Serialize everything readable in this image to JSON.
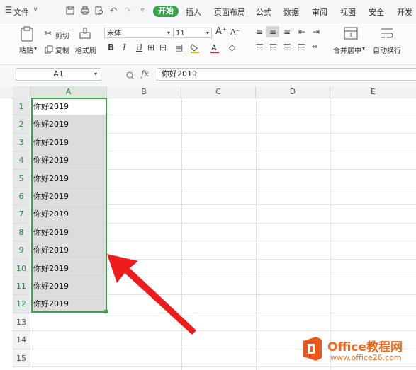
{
  "menubar": {
    "file": "文件",
    "tabs": [
      "开始",
      "插入",
      "页面布局",
      "公式",
      "数据",
      "审阅",
      "视图",
      "安全",
      "开发"
    ],
    "accent": "#3aa34c"
  },
  "ribbon": {
    "paste": "粘贴",
    "cut": "剪切",
    "copy": "复制",
    "format_painter": "格式刷",
    "font_name": "宋体",
    "font_size": "11",
    "bold": "B",
    "italic": "I",
    "underline": "U",
    "merge_center": "合并居中",
    "wrap_text": "自动换行"
  },
  "formula_bar": {
    "name_box": "A1",
    "fx_label": "fx",
    "value": "你好2019"
  },
  "sheet": {
    "columns": [
      "A",
      "B",
      "C",
      "D",
      "E"
    ],
    "rows": [
      "1",
      "2",
      "3",
      "4",
      "5",
      "6",
      "7",
      "8",
      "9",
      "10",
      "11",
      "12",
      "13",
      "14",
      "15"
    ],
    "cell_text": "你好2019",
    "filled_count": 12,
    "selection_color": "#3aa34c"
  },
  "watermark": {
    "brand": "Office教程网",
    "url": "www.office26.com"
  }
}
